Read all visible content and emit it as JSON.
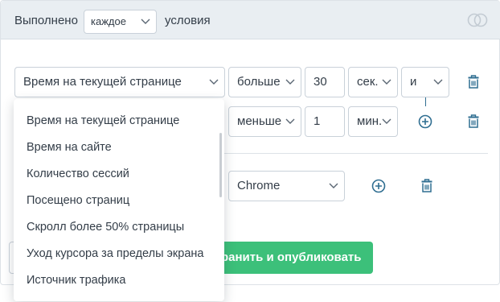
{
  "header": {
    "prefix": "Выполнено",
    "mode": "каждое",
    "suffix": "условия"
  },
  "rules": [
    {
      "field": "Время на текущей странице",
      "operator": "больше",
      "value": "30",
      "unit": "сек.",
      "join": "и"
    },
    {
      "operator": "меньше",
      "value": "1",
      "unit": "мин."
    }
  ],
  "browser_rule": {
    "value": "Chrome"
  },
  "buttons": {
    "save": "Сохранить и опубликовать"
  },
  "dropdown": {
    "items": [
      "Время на текущей странице",
      "Время на сайте",
      "Количество сессий",
      "Посещено страниц",
      "Скролл более 50% страницы",
      "Уход курсора за пределы экрана",
      "Источник трафика"
    ]
  },
  "colors": {
    "header_bg": "#e9eef2",
    "accent_icon": "#2f6e91",
    "save_button": "#3cc07a"
  },
  "icons": {
    "header": "overlapping-circles-icon",
    "delete": "trash-icon",
    "add": "plus-circle-icon",
    "dropdown": "chevron-down-icon"
  }
}
